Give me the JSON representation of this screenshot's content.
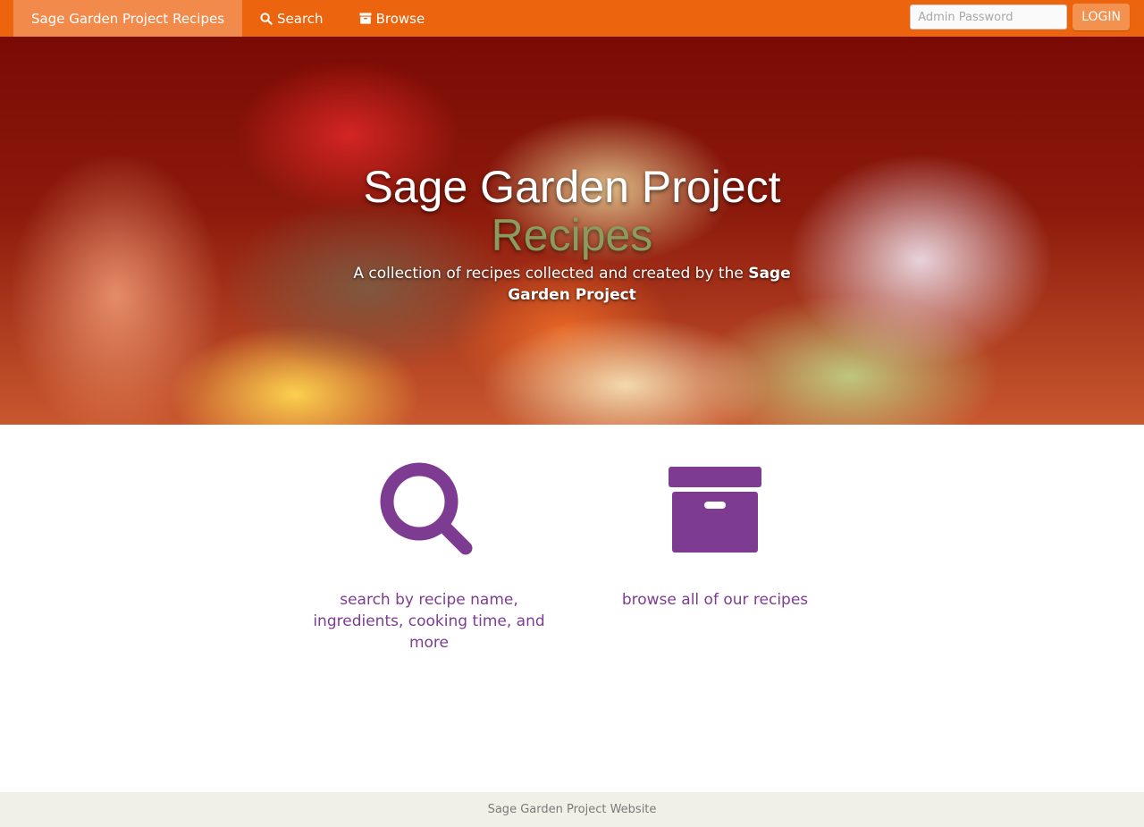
{
  "navbar": {
    "brand": "Sage Garden Project Recipes",
    "links": [
      {
        "label": "Search",
        "icon": "search-icon"
      },
      {
        "label": "Browse",
        "icon": "archive-icon"
      }
    ],
    "password_placeholder": "Admin Password",
    "login_label": "LOGIN"
  },
  "hero": {
    "title": "Sage Garden Project",
    "title_accent": "Recipes",
    "subtitle_prefix": "A collection of recipes collected and created by the ",
    "subtitle_bold": "Sage Garden Project"
  },
  "features": [
    {
      "icon": "search-icon",
      "label": "search by recipe name, ingredients, cooking time, and more"
    },
    {
      "icon": "archive-icon",
      "label": "browse all of our recipes"
    }
  ],
  "footer": {
    "text": "Sage Garden Project Website"
  },
  "colors": {
    "navbar": "#ed640f",
    "brand_active": "#f28a4b",
    "accent_purple": "#7d3c92",
    "title_green": "#8a9b5e",
    "footer_bg": "#f1f0e6"
  }
}
